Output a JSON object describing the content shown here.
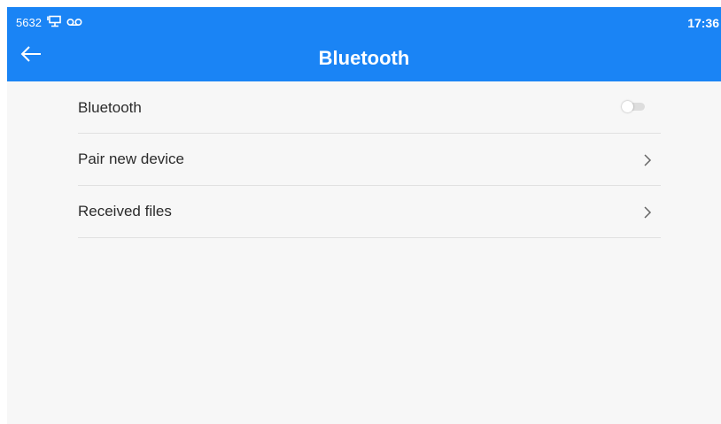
{
  "status_bar": {
    "left_text": "5632",
    "time": "17:36",
    "icons": [
      "network-icon",
      "voicemail-icon"
    ]
  },
  "app_bar": {
    "title": "Bluetooth",
    "back_icon": "arrow-left-icon",
    "color": "#1a84f5"
  },
  "settings": {
    "items": [
      {
        "label": "Bluetooth",
        "control": "toggle",
        "enabled": false
      },
      {
        "label": "Pair new device",
        "control": "chevron"
      },
      {
        "label": "Received files",
        "control": "chevron"
      }
    ]
  }
}
